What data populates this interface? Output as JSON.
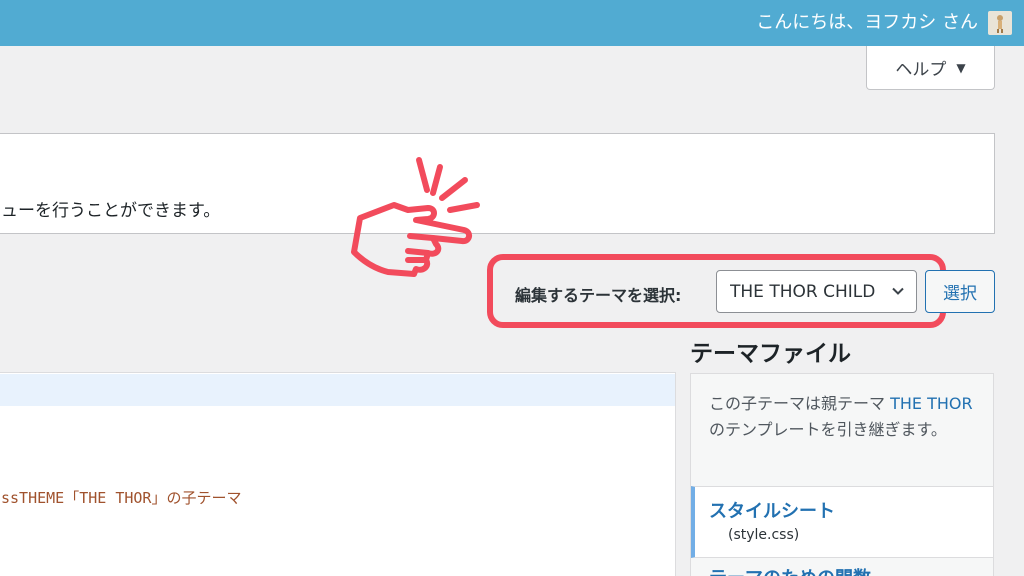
{
  "topbar": {
    "greeting": "こんにちは、ヨフカシ さん"
  },
  "help": {
    "label": "ヘルプ"
  },
  "notice": {
    "text": "ューを行うことができます。"
  },
  "theme_select": {
    "label": "編集するテーマを選択:",
    "value": "THE THOR CHILD",
    "button": "選択"
  },
  "editor": {
    "code_line": "ssTHEME「THE THOR」の子テーマ"
  },
  "files": {
    "heading": "テーマファイル",
    "desc_before": "この子テーマは親テーマ ",
    "desc_link": "THE THOR",
    "desc_after": " のテンプレートを引き継ぎます。",
    "active_name": "スタイルシート",
    "active_file": "(style.css)",
    "next_name": "テーマのための関数"
  },
  "colors": {
    "adminbar": "#51abd2",
    "annotation": "#f24b5c",
    "link": "#2271b1"
  },
  "icons": {
    "pointer": "pointing-hand-icon",
    "chevron": "chevron-down-icon",
    "help_caret": "caret-down-icon"
  }
}
